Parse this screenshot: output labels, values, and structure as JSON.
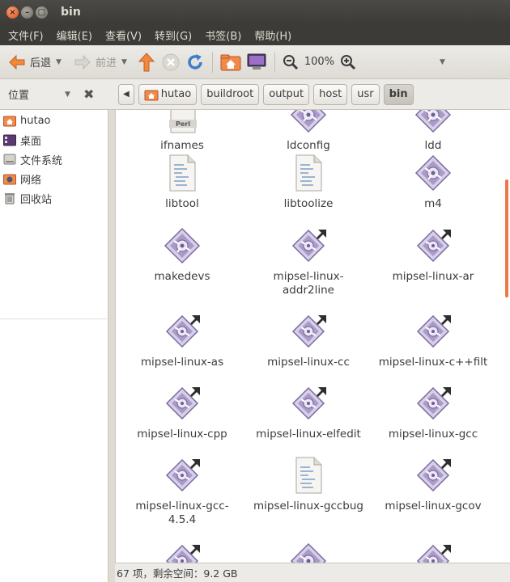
{
  "window": {
    "title": "bin"
  },
  "menu": [
    "文件(F)",
    "编辑(E)",
    "查看(V)",
    "转到(G)",
    "书签(B)",
    "帮助(H)"
  ],
  "toolbar": {
    "back_label": "后退",
    "forward_label": "前进",
    "zoom_level": "100%"
  },
  "sidebar": {
    "header_label": "位置",
    "items": [
      {
        "label": "hutao",
        "icon": "home-folder-icon"
      },
      {
        "label": "桌面",
        "icon": "desktop-icon"
      },
      {
        "label": "文件系统",
        "icon": "drive-icon"
      },
      {
        "label": "网络",
        "icon": "network-icon"
      },
      {
        "label": "回收站",
        "icon": "trash-icon"
      }
    ]
  },
  "path": [
    "hutao",
    "buildroot",
    "output",
    "host",
    "usr",
    "bin"
  ],
  "files": [
    {
      "name": "ifnames",
      "type": "perl"
    },
    {
      "name": "ldconfig",
      "type": "exec"
    },
    {
      "name": "ldd",
      "type": "exec"
    },
    {
      "name": "libtool",
      "type": "script"
    },
    {
      "name": "libtoolize",
      "type": "script"
    },
    {
      "name": "m4",
      "type": "exec"
    },
    {
      "name": "makedevs",
      "type": "exec"
    },
    {
      "name": "mipsel-linux-addr2line",
      "type": "link"
    },
    {
      "name": "mipsel-linux-ar",
      "type": "link"
    },
    {
      "name": "mipsel-linux-as",
      "type": "link"
    },
    {
      "name": "mipsel-linux-cc",
      "type": "link"
    },
    {
      "name": "mipsel-linux-c++filt",
      "type": "link"
    },
    {
      "name": "mipsel-linux-cpp",
      "type": "link"
    },
    {
      "name": "mipsel-linux-elfedit",
      "type": "link"
    },
    {
      "name": "mipsel-linux-gcc",
      "type": "link"
    },
    {
      "name": "mipsel-linux-gcc-4.5.4",
      "type": "link"
    },
    {
      "name": "mipsel-linux-gccbug",
      "type": "script"
    },
    {
      "name": "mipsel-linux-gcov",
      "type": "link"
    }
  ],
  "status": "67 项，剩余空间：9.2 GB",
  "colors": {
    "accent": "#f07746",
    "titlebar": "#3c3b37",
    "exec_icon": "#8a7ab0"
  }
}
